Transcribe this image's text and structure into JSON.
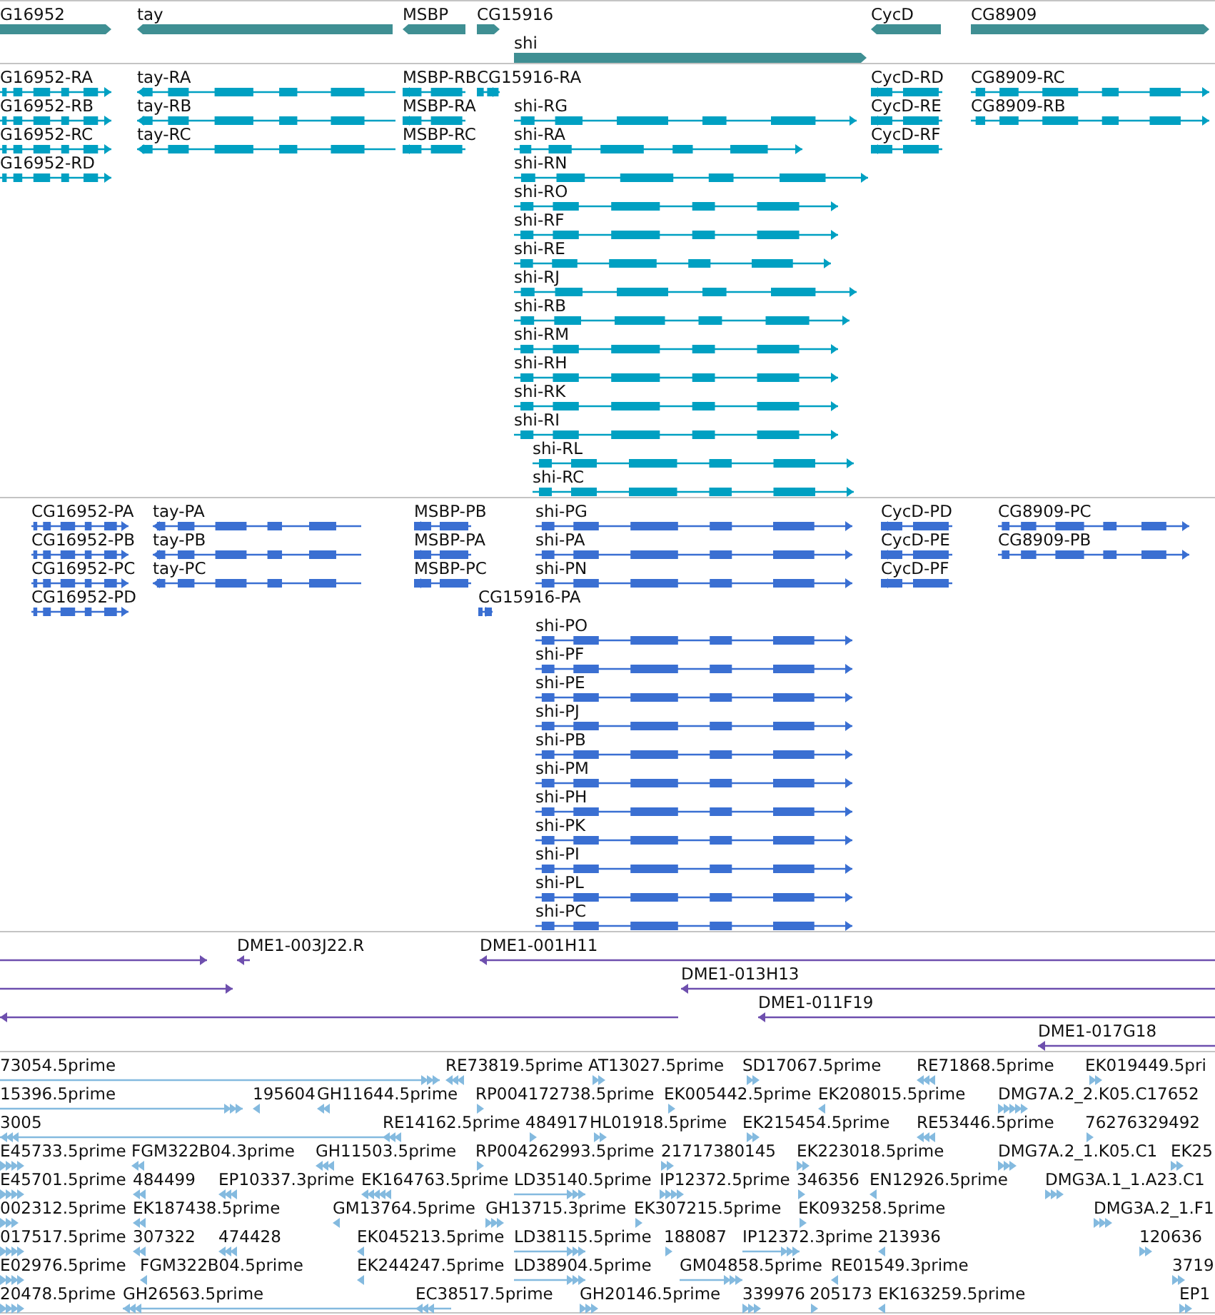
{
  "tracks": [
    {
      "kind": "gene",
      "features": [
        {
          "label": "G16952",
          "reverse": false
        },
        {
          "label": "tay",
          "reverse": true
        },
        {
          "label": "MSBP",
          "reverse": true
        },
        {
          "label": "CG15916",
          "reverse": false
        },
        {
          "label": "shi",
          "reverse": false
        },
        {
          "label": "CycD",
          "reverse": true
        },
        {
          "label": "CG8909",
          "reverse": false
        }
      ]
    },
    {
      "kind": "transcript",
      "groups": [
        {
          "features": [
            {
              "label": "G16952-RA",
              "reverse": false
            },
            {
              "label": "G16952-RB",
              "reverse": false
            },
            {
              "label": "G16952-RC",
              "reverse": false
            },
            {
              "label": "G16952-RD",
              "reverse": false
            }
          ]
        },
        {
          "features": [
            {
              "label": "tay-RA",
              "reverse": true
            },
            {
              "label": "tay-RB",
              "reverse": true
            },
            {
              "label": "tay-RC",
              "reverse": true
            }
          ]
        },
        {
          "features": [
            {
              "label": "MSBP-RB",
              "reverse": true
            },
            {
              "label": "MSBP-RA",
              "reverse": true
            },
            {
              "label": "MSBP-RC",
              "reverse": true
            }
          ]
        },
        {
          "features": [
            {
              "label": "CG15916-RA",
              "reverse": false
            }
          ]
        },
        {
          "features": [
            {
              "label": "shi-RG",
              "reverse": false
            },
            {
              "label": "shi-RA",
              "reverse": false
            },
            {
              "label": "shi-RN",
              "reverse": false
            },
            {
              "label": "shi-RO",
              "reverse": false
            },
            {
              "label": "shi-RF",
              "reverse": false
            },
            {
              "label": "shi-RE",
              "reverse": false
            },
            {
              "label": "shi-RJ",
              "reverse": false
            },
            {
              "label": "shi-RB",
              "reverse": false
            },
            {
              "label": "shi-RM",
              "reverse": false
            },
            {
              "label": "shi-RH",
              "reverse": false
            },
            {
              "label": "shi-RK",
              "reverse": false
            },
            {
              "label": "shi-RI",
              "reverse": false
            },
            {
              "label": "shi-RL",
              "reverse": false
            },
            {
              "label": "shi-RC",
              "reverse": false
            }
          ]
        },
        {
          "features": [
            {
              "label": "CycD-RD",
              "reverse": true
            },
            {
              "label": "CycD-RE",
              "reverse": true
            },
            {
              "label": "CycD-RF",
              "reverse": true
            }
          ]
        },
        {
          "features": [
            {
              "label": "CG8909-RC",
              "reverse": false
            },
            {
              "label": "CG8909-RB",
              "reverse": false
            }
          ]
        }
      ]
    },
    {
      "kind": "protein",
      "groups": [
        {
          "features": [
            {
              "label": "CG16952-PA",
              "reverse": false
            },
            {
              "label": "CG16952-PB",
              "reverse": false
            },
            {
              "label": "CG16952-PC",
              "reverse": false
            },
            {
              "label": "CG16952-PD",
              "reverse": false
            }
          ]
        },
        {
          "features": [
            {
              "label": "tay-PA",
              "reverse": true
            },
            {
              "label": "tay-PB",
              "reverse": true
            },
            {
              "label": "tay-PC",
              "reverse": true
            }
          ]
        },
        {
          "features": [
            {
              "label": "MSBP-PB",
              "reverse": true
            },
            {
              "label": "MSBP-PA",
              "reverse": true
            },
            {
              "label": "MSBP-PC",
              "reverse": true
            }
          ]
        },
        {
          "features": [
            {
              "label": "CG15916-PA",
              "reverse": false
            }
          ]
        },
        {
          "features": [
            {
              "label": "shi-PG",
              "reverse": false
            },
            {
              "label": "shi-PA",
              "reverse": false
            },
            {
              "label": "shi-PN",
              "reverse": false
            },
            {
              "label": "shi-PO",
              "reverse": false
            },
            {
              "label": "shi-PF",
              "reverse": false
            },
            {
              "label": "shi-PE",
              "reverse": false
            },
            {
              "label": "shi-PJ",
              "reverse": false
            },
            {
              "label": "shi-PB",
              "reverse": false
            },
            {
              "label": "shi-PM",
              "reverse": false
            },
            {
              "label": "shi-PH",
              "reverse": false
            },
            {
              "label": "shi-PK",
              "reverse": false
            },
            {
              "label": "shi-PI",
              "reverse": false
            },
            {
              "label": "shi-PL",
              "reverse": false
            },
            {
              "label": "shi-PC",
              "reverse": false
            }
          ]
        },
        {
          "features": [
            {
              "label": "CycD-PD",
              "reverse": true
            },
            {
              "label": "CycD-PE",
              "reverse": true
            },
            {
              "label": "CycD-PF",
              "reverse": true
            }
          ]
        },
        {
          "features": [
            {
              "label": "CG8909-PC",
              "reverse": false
            },
            {
              "label": "CG8909-PB",
              "reverse": false
            }
          ]
        }
      ]
    },
    {
      "kind": "clone",
      "features": [
        {
          "reverse": false
        },
        {
          "label": "DME1-003J22.R",
          "reverse": true
        },
        {
          "label": "DME1-001H11",
          "reverse": true
        },
        {
          "reverse": false
        },
        {
          "label": "DME1-013H13",
          "reverse": true
        },
        {
          "reverse": true
        },
        {
          "label": "DME1-011F19",
          "reverse": true
        },
        {
          "label": "DME1-017G18",
          "reverse": true
        }
      ]
    },
    {
      "kind": "est",
      "features": [
        {
          "label": "73054.5prime",
          "reverse": false
        },
        {
          "label": "RE73819.5prime",
          "reverse": true
        },
        {
          "label": "AT13027.5prime",
          "reverse": false
        },
        {
          "label": "SD17067.5prime",
          "reverse": false
        },
        {
          "label": "RE71868.5prime",
          "reverse": true
        },
        {
          "label": "EK019449.5pri",
          "reverse": false
        },
        {
          "label": "15396.5prime",
          "reverse": false
        },
        {
          "label": "195604",
          "reverse": true
        },
        {
          "label": "GH11644.5prime",
          "reverse": true
        },
        {
          "label": "RP004172738.5prime",
          "reverse": false
        },
        {
          "label": "EK005442.5prime",
          "reverse": false
        },
        {
          "label": "EK208015.5prime",
          "reverse": true
        },
        {
          "label": "DMG7A.2_2.K05.C17652",
          "reverse": false
        },
        {
          "label": "3005",
          "reverse": true
        },
        {
          "label": "RE14162.5prime",
          "reverse": true
        },
        {
          "label": "484917",
          "reverse": false
        },
        {
          "label": "HL01918.5prime",
          "reverse": false
        },
        {
          "label": "EK215454.5prime",
          "reverse": false
        },
        {
          "label": "RE53446.5prime",
          "reverse": true
        },
        {
          "label": "76276329492",
          "reverse": false
        },
        {
          "label": "E45733.5prime",
          "reverse": false
        },
        {
          "label": "FGM322B04.3prime",
          "reverse": true
        },
        {
          "label": "GH11503.5prime",
          "reverse": true
        },
        {
          "label": "RP004262993.5prime",
          "reverse": false
        },
        {
          "label": "21717380145",
          "reverse": false
        },
        {
          "label": "EK223018.5prime",
          "reverse": false
        },
        {
          "label": "DMG7A.2_1.K05.C1",
          "reverse": false
        },
        {
          "label": "EK25",
          "reverse": false
        },
        {
          "label": "E45701.5prime",
          "reverse": false
        },
        {
          "label": "484499",
          "reverse": true
        },
        {
          "label": "EP10337.3prime",
          "reverse": true
        },
        {
          "label": "EK164763.5prime",
          "reverse": true
        },
        {
          "label": "LD35140.5prime",
          "reverse": false
        },
        {
          "label": "IP12372.5prime",
          "reverse": false
        },
        {
          "label": "346356",
          "reverse": false
        },
        {
          "label": "EN12926.5prime",
          "reverse": true
        },
        {
          "label": "DMG3A.1_1.A23.C1",
          "reverse": false
        },
        {
          "label": "002312.5prime",
          "reverse": false
        },
        {
          "label": "EK187438.5prime",
          "reverse": true
        },
        {
          "label": "GM13764.5prime",
          "reverse": true
        },
        {
          "label": "GH13715.3prime",
          "reverse": false
        },
        {
          "label": "EK307215.5prime",
          "reverse": false
        },
        {
          "label": "EK093258.5prime",
          "reverse": false
        },
        {
          "label": "DMG3A.2_1.F1",
          "reverse": false
        },
        {
          "label": "017517.5prime",
          "reverse": false
        },
        {
          "label": "307322",
          "reverse": true
        },
        {
          "label": "474428",
          "reverse": true
        },
        {
          "label": "EK045213.5prime",
          "reverse": true
        },
        {
          "label": "LD38115.5prime",
          "reverse": false
        },
        {
          "label": "188087",
          "reverse": false
        },
        {
          "label": "IP12372.3prime",
          "reverse": false
        },
        {
          "label": "213936",
          "reverse": true
        },
        {
          "label": "120636",
          "reverse": false
        },
        {
          "label": "E02976.5prime",
          "reverse": false
        },
        {
          "label": "FGM322B04.5prime",
          "reverse": true
        },
        {
          "label": "EK244247.5prime",
          "reverse": true
        },
        {
          "label": "LD38904.5prime",
          "reverse": false
        },
        {
          "label": "GM04858.5prime",
          "reverse": false
        },
        {
          "label": "RE01549.3prime",
          "reverse": true
        },
        {
          "label": "3719",
          "reverse": false
        },
        {
          "label": "20478.5prime",
          "reverse": false
        },
        {
          "label": "GH26563.5prime",
          "reverse": true
        },
        {
          "label": "EC38517.5prime",
          "reverse": true
        },
        {
          "label": "GH20146.5prime",
          "reverse": false
        },
        {
          "label": "339976",
          "reverse": false
        },
        {
          "label": "205173",
          "reverse": false
        },
        {
          "label": "EK163259.5prime",
          "reverse": true
        },
        {
          "label": "EP1",
          "reverse": false
        }
      ]
    }
  ]
}
